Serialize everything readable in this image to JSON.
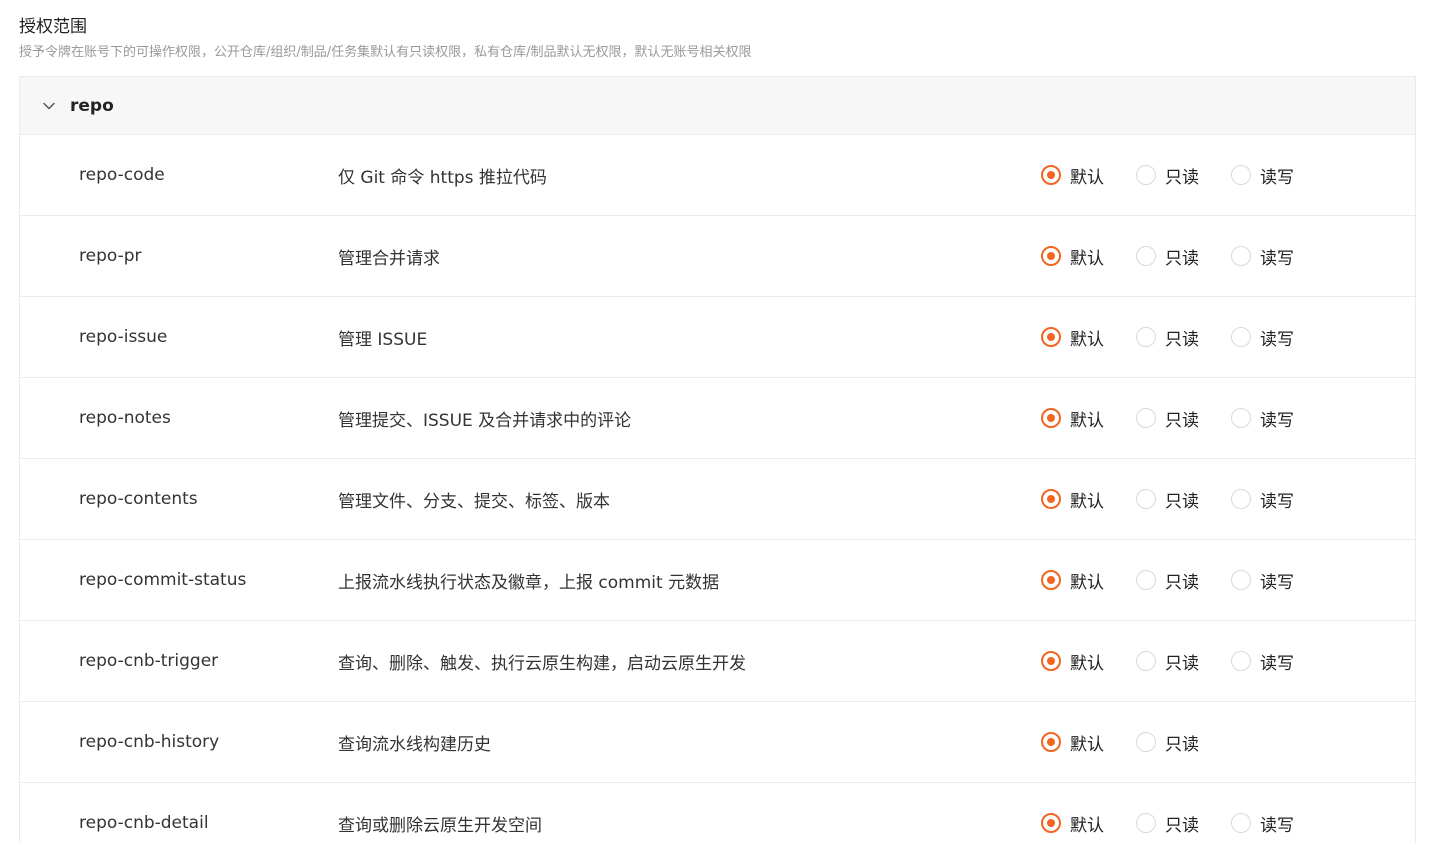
{
  "section": {
    "title": "授权范围",
    "description": "授予令牌在账号下的可操作权限，公开仓库/组织/制品/任务集默认有只读权限，私有仓库/制品默认无权限，默认无账号相关权限"
  },
  "colors": {
    "accent": "#f26522",
    "header_bg": "#f7f7f7",
    "border": "#ebebeb"
  },
  "group": {
    "name": "repo",
    "expanded": true,
    "icon": "chevron-down-icon"
  },
  "rows": [
    {
      "name": "repo-code",
      "description": "仅 Git 命令 https 推拉代码",
      "options": [
        {
          "label": "默认",
          "checked": true
        },
        {
          "label": "只读",
          "checked": false
        },
        {
          "label": "读写",
          "checked": false
        }
      ]
    },
    {
      "name": "repo-pr",
      "description": "管理合并请求",
      "options": [
        {
          "label": "默认",
          "checked": true
        },
        {
          "label": "只读",
          "checked": false
        },
        {
          "label": "读写",
          "checked": false
        }
      ]
    },
    {
      "name": "repo-issue",
      "description": "管理 ISSUE",
      "options": [
        {
          "label": "默认",
          "checked": true
        },
        {
          "label": "只读",
          "checked": false
        },
        {
          "label": "读写",
          "checked": false
        }
      ]
    },
    {
      "name": "repo-notes",
      "description": "管理提交、ISSUE 及合并请求中的评论",
      "options": [
        {
          "label": "默认",
          "checked": true
        },
        {
          "label": "只读",
          "checked": false
        },
        {
          "label": "读写",
          "checked": false
        }
      ]
    },
    {
      "name": "repo-contents",
      "description": "管理文件、分支、提交、标签、版本",
      "options": [
        {
          "label": "默认",
          "checked": true
        },
        {
          "label": "只读",
          "checked": false
        },
        {
          "label": "读写",
          "checked": false
        }
      ]
    },
    {
      "name": "repo-commit-status",
      "description": "上报流水线执行状态及徽章，上报 commit 元数据",
      "options": [
        {
          "label": "默认",
          "checked": true
        },
        {
          "label": "只读",
          "checked": false
        },
        {
          "label": "读写",
          "checked": false
        }
      ]
    },
    {
      "name": "repo-cnb-trigger",
      "description": "查询、删除、触发、执行云原生构建，启动云原生开发",
      "options": [
        {
          "label": "默认",
          "checked": true
        },
        {
          "label": "只读",
          "checked": false
        },
        {
          "label": "读写",
          "checked": false
        }
      ]
    },
    {
      "name": "repo-cnb-history",
      "description": "查询流水线构建历史",
      "options": [
        {
          "label": "默认",
          "checked": true
        },
        {
          "label": "只读",
          "checked": false
        }
      ]
    },
    {
      "name": "repo-cnb-detail",
      "description": "查询或删除云原生开发空间",
      "options": [
        {
          "label": "默认",
          "checked": true
        },
        {
          "label": "只读",
          "checked": false
        },
        {
          "label": "读写",
          "checked": false
        }
      ]
    }
  ]
}
